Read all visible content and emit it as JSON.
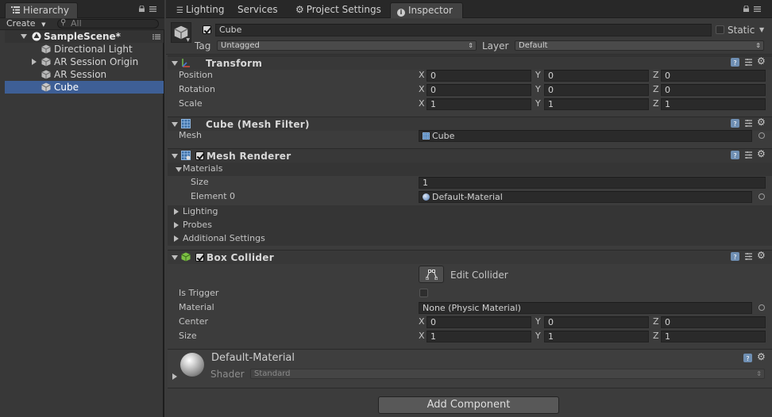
{
  "hierarchy": {
    "tab_label": "Hierarchy",
    "create_label": "Create",
    "search_placeholder": "All",
    "scene_name": "SampleScene*",
    "items": [
      {
        "label": "Directional Light"
      },
      {
        "label": "AR Session Origin"
      },
      {
        "label": "AR Session"
      },
      {
        "label": "Cube"
      }
    ]
  },
  "tabs": {
    "lighting": "Lighting",
    "services": "Services",
    "project_settings": "Project Settings",
    "inspector": "Inspector"
  },
  "object": {
    "name": "Cube",
    "static_label": "Static",
    "tag_label": "Tag",
    "tag_value": "Untagged",
    "layer_label": "Layer",
    "layer_value": "Default"
  },
  "transform": {
    "title": "Transform",
    "position_label": "Position",
    "rotation_label": "Rotation",
    "scale_label": "Scale",
    "x_label": "X",
    "y_label": "Y",
    "z_label": "Z",
    "position": {
      "x": "0",
      "y": "0",
      "z": "0"
    },
    "rotation": {
      "x": "0",
      "y": "0",
      "z": "0"
    },
    "scale": {
      "x": "1",
      "y": "1",
      "z": "1"
    }
  },
  "mesh_filter": {
    "title": "Cube (Mesh Filter)",
    "mesh_label": "Mesh",
    "mesh_value": "Cube"
  },
  "mesh_renderer": {
    "title": "Mesh Renderer",
    "materials_label": "Materials",
    "size_label": "Size",
    "size_value": "1",
    "element0_label": "Element 0",
    "element0_value": "Default-Material",
    "lighting_label": "Lighting",
    "probes_label": "Probes",
    "additional_label": "Additional Settings"
  },
  "box_collider": {
    "title": "Box Collider",
    "edit_collider_label": "Edit Collider",
    "is_trigger_label": "Is Trigger",
    "material_label": "Material",
    "material_value": "None (Physic Material)",
    "center_label": "Center",
    "size_label": "Size",
    "center": {
      "x": "0",
      "y": "0",
      "z": "0"
    },
    "size": {
      "x": "1",
      "y": "1",
      "z": "1"
    }
  },
  "material_preview": {
    "name": "Default-Material",
    "shader_label": "Shader",
    "shader_value": "Standard"
  },
  "add_component_label": "Add Component"
}
